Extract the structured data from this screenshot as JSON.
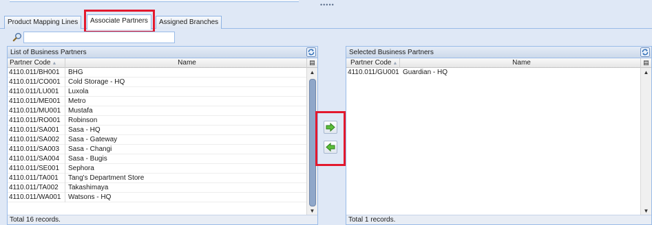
{
  "tabs": [
    {
      "label": "Product Mapping Lines",
      "active": false
    },
    {
      "label": "Associate Partners",
      "active": true
    },
    {
      "label": "Assigned Branches",
      "active": false
    }
  ],
  "search": {
    "value": "",
    "placeholder": ""
  },
  "drag_handle": "•••••",
  "left_panel": {
    "title": "List of Business Partners",
    "columns": {
      "code": "Partner Code",
      "name": "Name"
    },
    "rows": [
      {
        "code": "4110.011/BH001",
        "name": "BHG"
      },
      {
        "code": "4110.011/CO001",
        "name": "Cold Storage - HQ"
      },
      {
        "code": "4110.011/LU001",
        "name": "Luxola"
      },
      {
        "code": "4110.011/ME001",
        "name": "Metro"
      },
      {
        "code": "4110.011/MU001",
        "name": "Mustafa"
      },
      {
        "code": "4110.011/RO001",
        "name": "Robinson"
      },
      {
        "code": "4110.011/SA001",
        "name": "Sasa - HQ"
      },
      {
        "code": "4110.011/SA002",
        "name": "Sasa - Gateway"
      },
      {
        "code": "4110.011/SA003",
        "name": "Sasa - Changi"
      },
      {
        "code": "4110.011/SA004",
        "name": "Sasa - Bugis"
      },
      {
        "code": "4110.011/SE001",
        "name": "Sephora"
      },
      {
        "code": "4110.011/TA001",
        "name": "Tang's Department Store"
      },
      {
        "code": "4110.011/TA002",
        "name": "Takashimaya"
      },
      {
        "code": "4110.011/WA001",
        "name": "Watsons - HQ"
      }
    ],
    "footer": "Total 16 records."
  },
  "right_panel": {
    "title": "Selected Business Partners",
    "columns": {
      "code": "Partner Code",
      "name": "Name"
    },
    "rows": [
      {
        "code": "4110.011/GU001",
        "name": "Guardian - HQ"
      }
    ],
    "footer": "Total 1 records."
  },
  "colors": {
    "highlight": "#e3182d",
    "accent": "#99bbe8",
    "arrow_green": "#4caf30"
  },
  "icons": {
    "search": "search-icon",
    "refresh": "refresh-icon",
    "add": "arrow-right-icon",
    "remove": "arrow-left-icon"
  }
}
